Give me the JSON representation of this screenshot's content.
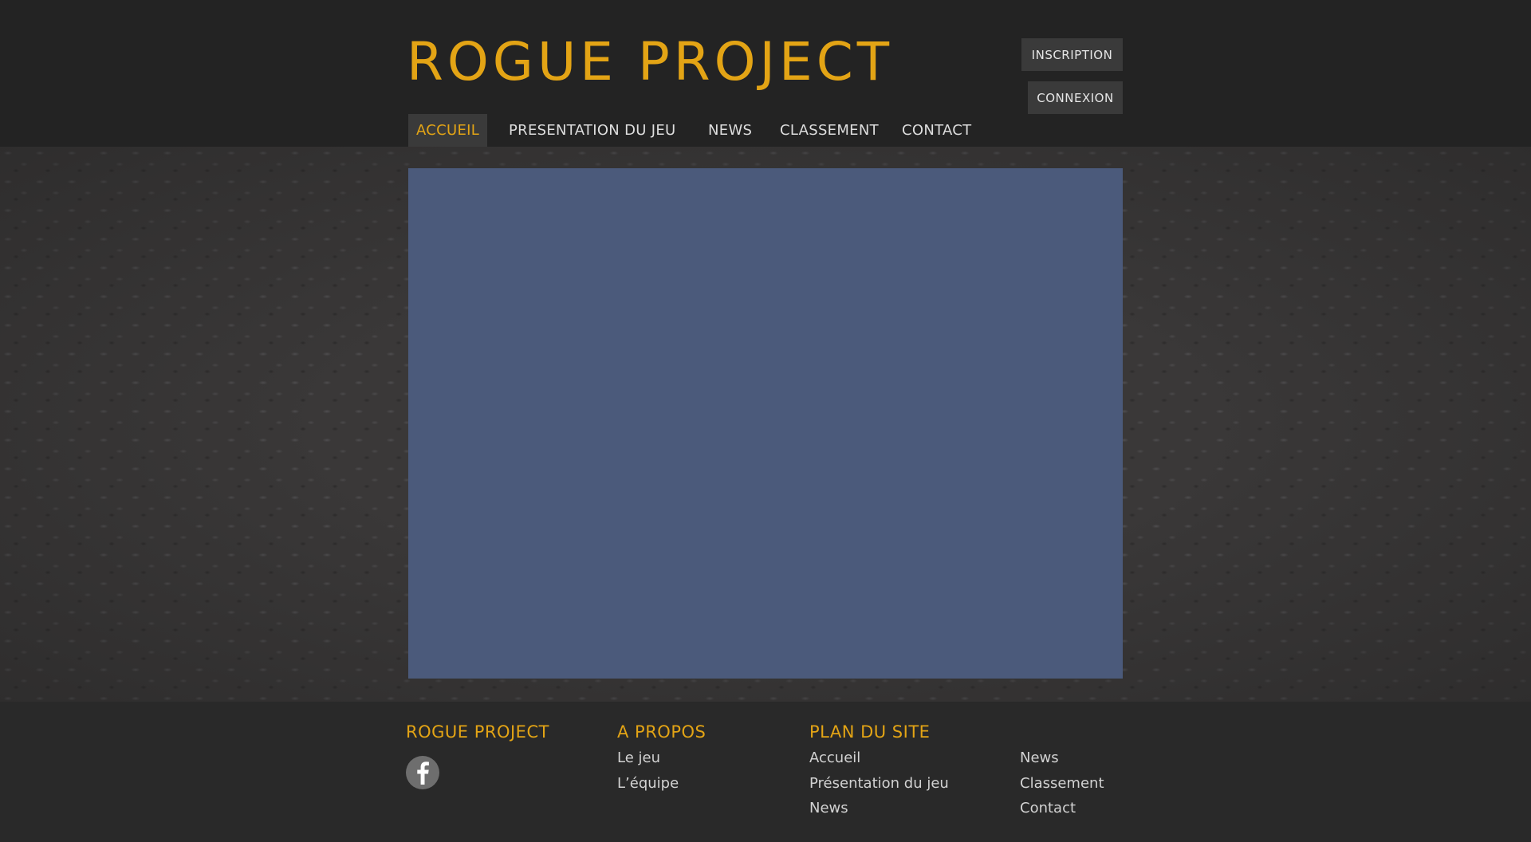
{
  "header": {
    "site_title": "ROGUE PROJECT",
    "inscription_label": "INSCRIPTION",
    "connexion_label": "CONNEXION"
  },
  "nav": {
    "items": [
      {
        "label": "ACCUEIL",
        "active": true
      },
      {
        "label": "PRESENTATION DU JEU",
        "active": false
      },
      {
        "label": "NEWS",
        "active": false
      },
      {
        "label": "CLASSEMENT",
        "active": false
      },
      {
        "label": "CONTACT",
        "active": false
      }
    ]
  },
  "footer": {
    "brand": {
      "heading": "ROGUE PROJECT",
      "social_icon": "facebook-icon"
    },
    "about": {
      "heading": "A PROPOS",
      "links": [
        "Le jeu",
        "L’équipe"
      ]
    },
    "sitemap": {
      "heading": "PLAN DU SITE",
      "col1": [
        "Accueil",
        "Présentation du jeu",
        "News"
      ],
      "col2": [
        "News",
        "Classement",
        "Contact"
      ]
    }
  },
  "colors": {
    "accent": "#e3a415",
    "header_bg": "#232323",
    "footer_bg": "#292929",
    "slideshow_bg": "#4b5a7b",
    "button_bg": "#3a3a3a"
  }
}
